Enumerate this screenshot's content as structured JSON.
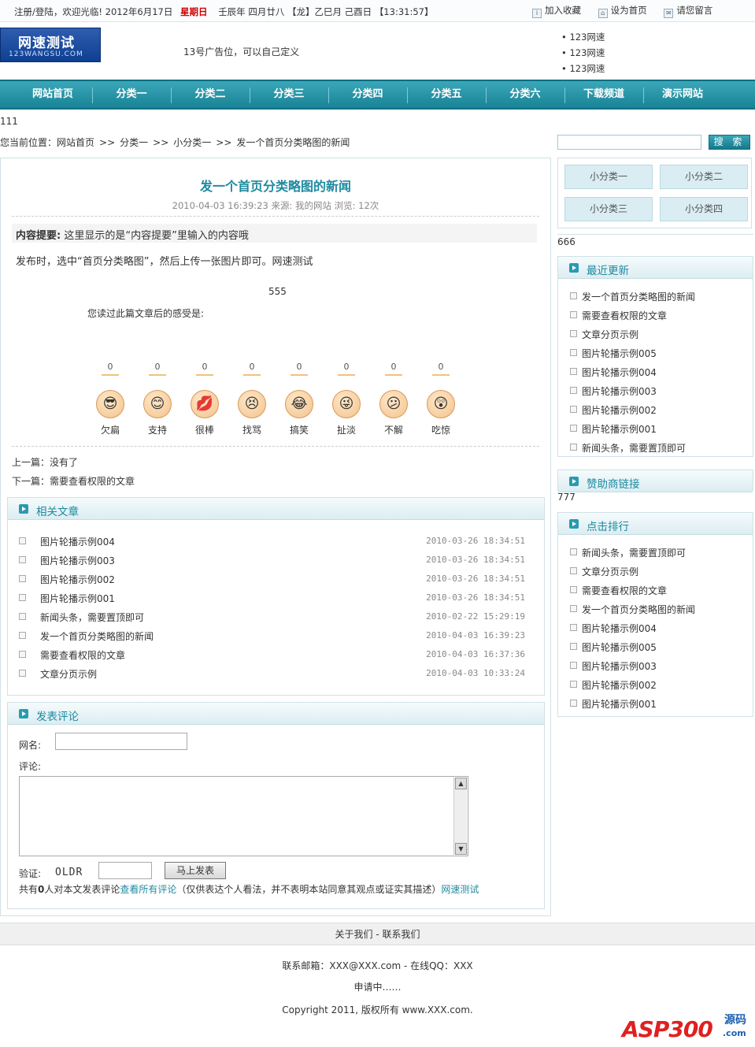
{
  "topbar": {
    "login": "注册/登陆",
    "welcome": "，欢迎光临!",
    "date": "2012年6月17日",
    "weekday": "星期日",
    "lunar": "壬辰年 四月廿八 【龙】乙巳月 己酉日",
    "time": "【13:31:57】",
    "bookmark": "加入收藏",
    "homepage": "设为首页",
    "message": "请您留言"
  },
  "header": {
    "logo_text": "网速测试",
    "logo_sub": "123WANGSU.COM",
    "ad_text": "13号广告位，可以自己定义",
    "links": [
      "123网速",
      "123网速",
      "123网速"
    ]
  },
  "nav": [
    "网站首页",
    "分类一",
    "分类二",
    "分类三",
    "分类四",
    "分类五",
    "分类六",
    "下载频道",
    "演示网站"
  ],
  "num111": "111",
  "breadcrumb": {
    "prefix": "您当前位置：",
    "items": [
      "网站首页",
      "分类一",
      "小分类一",
      "发一个首页分类略图的新闻"
    ],
    "sep": ">>"
  },
  "search": {
    "button": "搜 索"
  },
  "article": {
    "title": "发一个首页分类略图的新闻",
    "meta": "2010-04-03 16:39:23 来源: 我的网站 浏览: 12次",
    "summary_label": "内容提要:",
    "summary": "这里显示的是“内容提要”里输入的内容哦",
    "content": "发布时，选中“首页分类略图”，然后上传一张图片即可。网速测试",
    "num555": "555",
    "feel_prompt": "您读过此篇文章后的感受是:",
    "moods": [
      {
        "count": "0",
        "label": "欠扁",
        "face": "😎"
      },
      {
        "count": "0",
        "label": "支持",
        "face": "😊"
      },
      {
        "count": "0",
        "label": "很棒",
        "face": "💋"
      },
      {
        "count": "0",
        "label": "找骂",
        "face": "😣"
      },
      {
        "count": "0",
        "label": "搞笑",
        "face": "😂"
      },
      {
        "count": "0",
        "label": "扯淡",
        "face": "😜"
      },
      {
        "count": "0",
        "label": "不解",
        "face": "😕"
      },
      {
        "count": "0",
        "label": "吃惊",
        "face": "😲"
      }
    ],
    "prev": "上一篇：没有了",
    "next": "下一篇：需要查看权限的文章"
  },
  "related": {
    "title": "相关文章",
    "items": [
      {
        "title": "图片轮播示例004",
        "date": "2010-03-26 18:34:51"
      },
      {
        "title": "图片轮播示例003",
        "date": "2010-03-26 18:34:51"
      },
      {
        "title": "图片轮播示例002",
        "date": "2010-03-26 18:34:51"
      },
      {
        "title": "图片轮播示例001",
        "date": "2010-03-26 18:34:51"
      },
      {
        "title": "新闻头条，需要置顶即可",
        "date": "2010-02-22 15:29:19"
      },
      {
        "title": "发一个首页分类略图的新闻",
        "date": "2010-04-03 16:39:23"
      },
      {
        "title": "需要查看权限的文章",
        "date": "2010-04-03 16:37:36"
      },
      {
        "title": "文章分页示例",
        "date": "2010-04-03 10:33:24"
      }
    ]
  },
  "comment": {
    "title": "发表评论",
    "name_label": "网名:",
    "body_label": "评论:",
    "captcha_label": "验证:",
    "captcha_code": "OLDR",
    "submit": "马上发表",
    "note_prefix": "共有",
    "note_count": "0",
    "note_mid": "人对本文发表评论",
    "note_link": "查看所有评论",
    "note_suffix": "（仅供表达个人看法，并不表明本站同意其观点或证实其描述）",
    "note_site": "网速测试"
  },
  "sidebar": {
    "categories": [
      "小分类一",
      "小分类二",
      "小分类三",
      "小分类四"
    ],
    "num666": "666",
    "recent_title": "最近更新",
    "recent": [
      "发一个首页分类略图的新闻",
      "需要查看权限的文章",
      "文章分页示例",
      "图片轮播示例005",
      "图片轮播示例004",
      "图片轮播示例003",
      "图片轮播示例002",
      "图片轮播示例001",
      "新闻头条，需要置顶即可"
    ],
    "sponsor_title": "赞助商链接",
    "num777": "777",
    "rank_title": "点击排行",
    "rank": [
      "新闻头条，需要置顶即可",
      "文章分页示例",
      "需要查看权限的文章",
      "发一个首页分类略图的新闻",
      "图片轮播示例004",
      "图片轮播示例005",
      "图片轮播示例003",
      "图片轮播示例002",
      "图片轮播示例001"
    ]
  },
  "footer": {
    "links": "关于我们 - 联系我们",
    "contact": "联系邮箱：XXX@XXX.com - 在线QQ：XXX",
    "icp": "申请中……",
    "copyright": "Copyright 2011, 版权所有 www.XXX.com.",
    "watermark": "ASP300",
    "watermark_b": "源码",
    "watermark_c": ".com"
  }
}
